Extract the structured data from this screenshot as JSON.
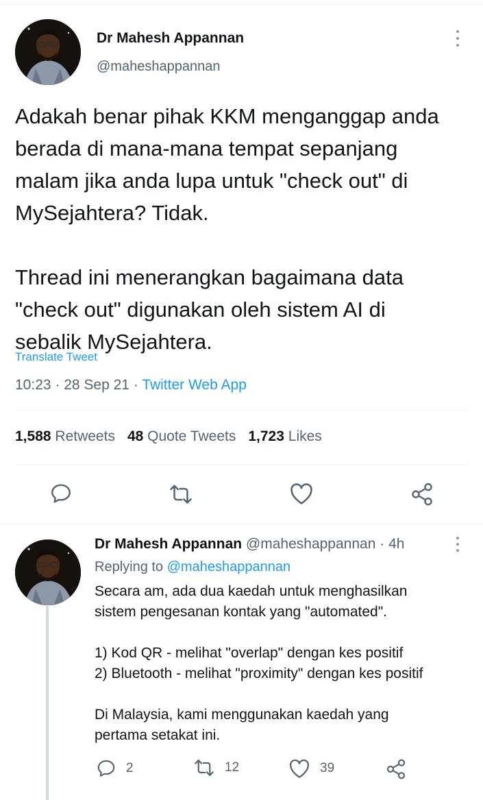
{
  "colors": {
    "text": "#0f1419",
    "muted": "#536471",
    "link": "#1d9bf0",
    "divider": "#eff3f4",
    "thread_line": "#cfd9de"
  },
  "tweet": {
    "author_name": "Dr Mahesh Appannan",
    "author_handle": "@maheshappannan",
    "text": "Adakah benar pihak KKM menganggap anda\nberada di mana-mana tempat sepanjang\nmalam jika anda lupa untuk \"check out\" di\nMySejahtera? Tidak.\n\nThread ini menerangkan bagaimana data\n\"check out\" digunakan oleh sistem AI di\nsebalik MySejahtera.",
    "translate_label": "Translate Tweet",
    "time": "10:23",
    "date": "28 Sep 21",
    "separator": " · ",
    "source_app": "Twitter Web App",
    "stats": {
      "retweets_count": "1,588",
      "retweets_label": "Retweets",
      "quotes_count": "48",
      "quotes_label": "Quote Tweets",
      "likes_count": "1,723",
      "likes_label": "Likes"
    },
    "actions": [
      "reply-icon",
      "retweet-icon",
      "like-icon",
      "share-icon"
    ]
  },
  "reply": {
    "author_name": "Dr Mahesh Appannan",
    "author_handle": "@maheshappannan",
    "separator": " · ",
    "time": "4h",
    "replying_label": "Replying to",
    "replying_to": "@maheshappannan",
    "text": "Secara am, ada dua kaedah untuk menghasilkan\nsistem pengesanan kontak yang \"automated\".\n\n1) Kod QR - melihat \"overlap\" dengan kes positif\n2) Bluetooth - melihat \"proximity\" dengan kes positif\n\nDi Malaysia, kami menggunakan kaedah yang\npertama setakat ini.",
    "reply_count": "2",
    "retweet_count": "12",
    "like_count": "39"
  }
}
